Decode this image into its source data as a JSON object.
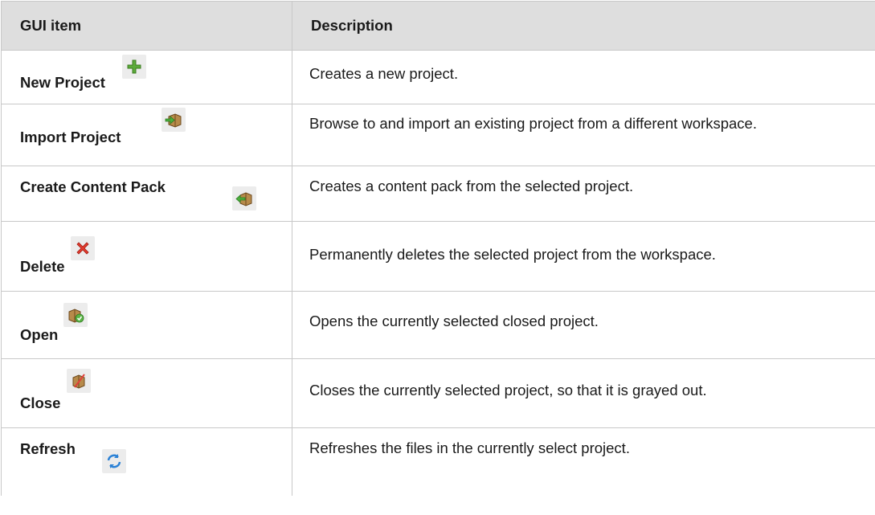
{
  "table": {
    "headers": {
      "col1": "GUI item",
      "col2": "Description"
    },
    "rows": [
      {
        "label": "New Project",
        "icon": "plus-icon",
        "desc": "Creates a new project."
      },
      {
        "label": "Import Project",
        "icon": "import-project-icon",
        "desc": "Browse to and import an existing project from a different workspace."
      },
      {
        "label": "Create Content Pack",
        "icon": "content-pack-icon",
        "desc": "Creates a content pack from the selected project."
      },
      {
        "label": "Delete",
        "icon": "red-x-icon",
        "desc": "Permanently deletes the selected project from the workspace."
      },
      {
        "label": "Open",
        "icon": "open-project-icon",
        "desc": "Opens the currently selected closed project."
      },
      {
        "label": "Close",
        "icon": "close-project-icon",
        "desc": "Closes the currently selected project, so that it is grayed out."
      },
      {
        "label": "Refresh",
        "icon": "refresh-icon",
        "desc": "Refreshes the files in the currently select project."
      }
    ]
  }
}
